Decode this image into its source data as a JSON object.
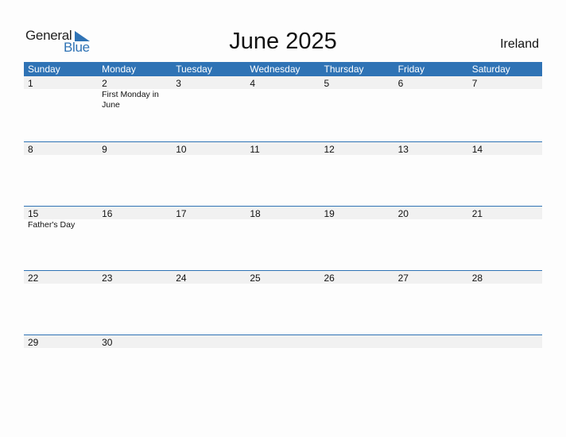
{
  "logo": {
    "text_general": "General",
    "text_blue": "Blue"
  },
  "header": {
    "title": "June 2025",
    "country": "Ireland"
  },
  "colors": {
    "accent": "#2f73b5",
    "date_row_bg": "#f1f1f1"
  },
  "weekdays": [
    "Sunday",
    "Monday",
    "Tuesday",
    "Wednesday",
    "Thursday",
    "Friday",
    "Saturday"
  ],
  "weeks": [
    {
      "days": [
        {
          "num": "1",
          "event": ""
        },
        {
          "num": "2",
          "event": "First Monday in June"
        },
        {
          "num": "3",
          "event": ""
        },
        {
          "num": "4",
          "event": ""
        },
        {
          "num": "5",
          "event": ""
        },
        {
          "num": "6",
          "event": ""
        },
        {
          "num": "7",
          "event": ""
        }
      ]
    },
    {
      "days": [
        {
          "num": "8",
          "event": ""
        },
        {
          "num": "9",
          "event": ""
        },
        {
          "num": "10",
          "event": ""
        },
        {
          "num": "11",
          "event": ""
        },
        {
          "num": "12",
          "event": ""
        },
        {
          "num": "13",
          "event": ""
        },
        {
          "num": "14",
          "event": ""
        }
      ]
    },
    {
      "days": [
        {
          "num": "15",
          "event": "Father's Day"
        },
        {
          "num": "16",
          "event": ""
        },
        {
          "num": "17",
          "event": ""
        },
        {
          "num": "18",
          "event": ""
        },
        {
          "num": "19",
          "event": ""
        },
        {
          "num": "20",
          "event": ""
        },
        {
          "num": "21",
          "event": ""
        }
      ]
    },
    {
      "days": [
        {
          "num": "22",
          "event": ""
        },
        {
          "num": "23",
          "event": ""
        },
        {
          "num": "24",
          "event": ""
        },
        {
          "num": "25",
          "event": ""
        },
        {
          "num": "26",
          "event": ""
        },
        {
          "num": "27",
          "event": ""
        },
        {
          "num": "28",
          "event": ""
        }
      ]
    },
    {
      "days": [
        {
          "num": "29",
          "event": ""
        },
        {
          "num": "30",
          "event": ""
        },
        {
          "num": "",
          "event": ""
        },
        {
          "num": "",
          "event": ""
        },
        {
          "num": "",
          "event": ""
        },
        {
          "num": "",
          "event": ""
        },
        {
          "num": "",
          "event": ""
        }
      ]
    }
  ]
}
